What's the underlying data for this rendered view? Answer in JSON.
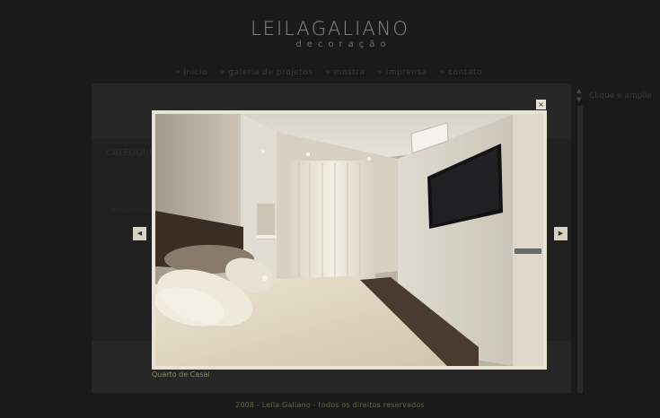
{
  "logo": {
    "name_part1": "LEILA",
    "name_part2": "GALIANO",
    "subtitle": "decoração"
  },
  "nav": [
    {
      "label": "inicio"
    },
    {
      "label": "galeria de projetos"
    },
    {
      "label": "mostra"
    },
    {
      "label": "imprensa"
    },
    {
      "label": "contato"
    }
  ],
  "page": {
    "section_title": "CATEGORIA",
    "body_text": "Residencial",
    "side_link": "Clique e amplie"
  },
  "lightbox": {
    "close_label": "×",
    "prev_label": "◀",
    "next_label": "▶",
    "caption": "Quarto de Casal"
  },
  "footer": {
    "text": "2008 - Leila Galiano - todos os direitos reservados"
  },
  "colors": {
    "frame": "#e6e4d2",
    "footer_text": "#6b6536",
    "caption_text": "#8f8a56"
  },
  "icons": [
    "close-icon",
    "prev-arrow-icon",
    "next-arrow-icon"
  ]
}
